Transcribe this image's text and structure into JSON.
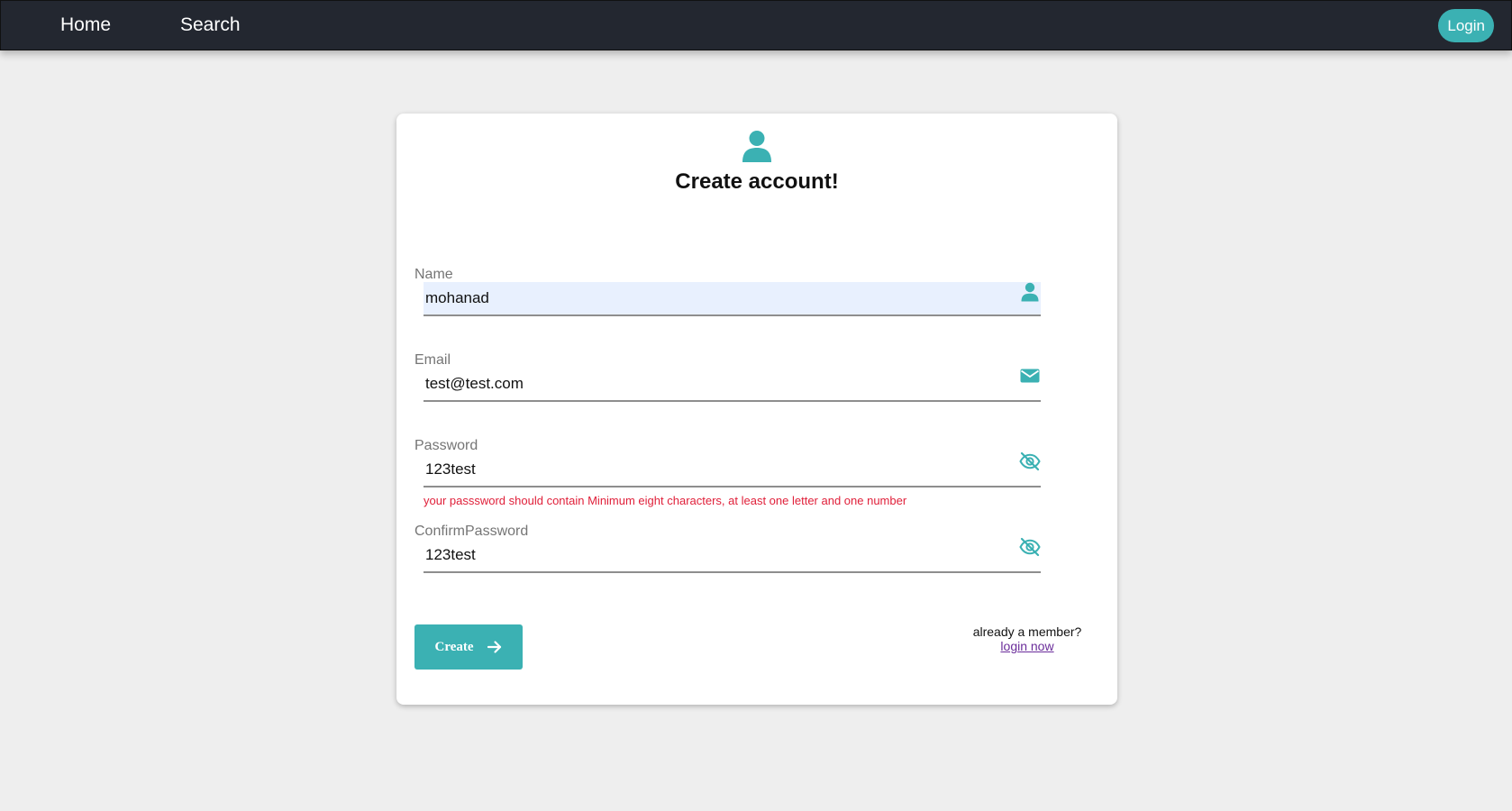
{
  "nav": {
    "home": "Home",
    "search": "Search",
    "login": "Login"
  },
  "card": {
    "title": "Create account!"
  },
  "form": {
    "name": {
      "label": "Name",
      "value": "mohanad"
    },
    "email": {
      "label": "Email",
      "value": "test@test.com"
    },
    "password": {
      "label": "Password",
      "value": "123test",
      "error": "your passsword should contain Minimum eight characters, at least one letter and one number"
    },
    "confirm_password": {
      "label": "ConfirmPassword",
      "value": "123test"
    },
    "submit_label": "Create"
  },
  "footer": {
    "member_text": "already a member?",
    "login_link": "login now"
  },
  "icons": {
    "header": "user-icon",
    "name": "user-icon",
    "email": "envelope-icon",
    "password": "eye-slash-icon",
    "confirm_password": "eye-slash-icon",
    "submit": "arrow-right-icon"
  },
  "colors": {
    "accent": "#3bb1b3",
    "navbar": "#232730",
    "error": "#e0203a",
    "background": "#eeeeee",
    "link": "#6a2c9a"
  }
}
